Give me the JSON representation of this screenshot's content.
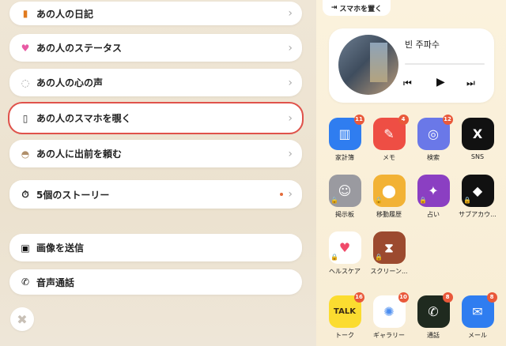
{
  "menu": [
    {
      "label": "あの人の日記",
      "icon": "diary-icon"
    },
    {
      "label": "あの人のステータス",
      "icon": "heart-icon"
    },
    {
      "label": "あの人の心の声",
      "icon": "speech-bubble-icon"
    },
    {
      "label": "あの人のスマホを覗く",
      "icon": "phone-icon"
    },
    {
      "label": "あの人に出前を頼む",
      "icon": "food-delivery-icon"
    },
    {
      "label": "5個のストーリー",
      "icon": "stopwatch-icon"
    },
    {
      "label": "画像を送信",
      "icon": "image-icon"
    },
    {
      "label": "音声通話",
      "icon": "call-icon"
    }
  ],
  "chevron": "›",
  "close_glyph": "✖",
  "put_down_label": "スマホを置く",
  "music": {
    "title": "빈 주파수",
    "prev": "⏮",
    "play": "▶",
    "next": "⏭"
  },
  "apps": [
    {
      "name": "家計簿",
      "badge": "11",
      "color": "#2f7df0",
      "glyph": "▥",
      "locked": false
    },
    {
      "name": "メモ",
      "badge": "4",
      "color": "#ee4e44",
      "glyph": "✎",
      "locked": false
    },
    {
      "name": "検索",
      "badge": "12",
      "color": "#6a78e8",
      "glyph": "◎",
      "locked": false
    },
    {
      "name": "SNS",
      "badge": "",
      "color": "#111111",
      "glyph": "X",
      "locked": false
    },
    {
      "name": "掲示板",
      "badge": "",
      "color": "#9a9aa0",
      "glyph": "☺",
      "locked": true
    },
    {
      "name": "移動履歴",
      "badge": "",
      "color": "#f2b235",
      "glyph": "⬤",
      "locked": true
    },
    {
      "name": "占い",
      "badge": "",
      "color": "#8b3fc2",
      "glyph": "✦",
      "locked": true
    },
    {
      "name": "サブアカウ...",
      "badge": "",
      "color": "#111111",
      "glyph": "◆",
      "locked": true
    },
    {
      "name": "ヘルスケア",
      "badge": "",
      "color": "#ffffff",
      "glyph": "♥",
      "locked": true
    },
    {
      "name": "スクリーン...",
      "badge": "",
      "color": "#9c4a2f",
      "glyph": "⧗",
      "locked": true
    },
    {
      "name": "トーク",
      "badge": "16",
      "color": "#fbdc30",
      "glyph": "TALK",
      "locked": false
    },
    {
      "name": "ギャラリー",
      "badge": "10",
      "color": "#ffffff",
      "glyph": "✺",
      "locked": false
    },
    {
      "name": "通話",
      "badge": "8",
      "color": "#1f2a1f",
      "glyph": "✆",
      "locked": false
    },
    {
      "name": "メール",
      "badge": "8",
      "color": "#2f7df0",
      "glyph": "✉",
      "locked": false
    }
  ]
}
